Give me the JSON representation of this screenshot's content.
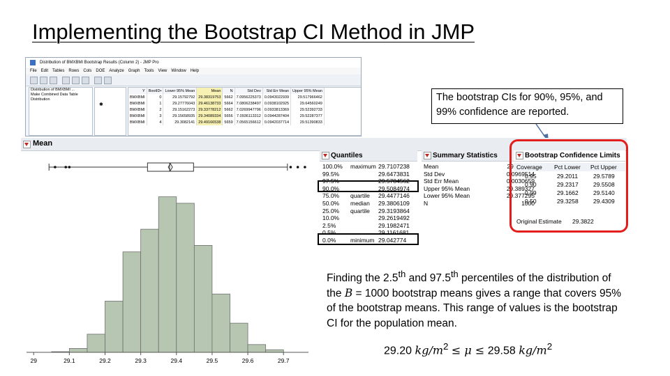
{
  "slide": {
    "title": "Implementing the Bootstrap CI Method in JMP",
    "callout": "The bootstrap CIs for 90%, 95%, and 99% confidence are reported."
  },
  "jmp_window": {
    "title": "Distribution of BMXBMI Bootstrap Results (Column 2) - JMP Pro",
    "menu": [
      "File",
      "Edit",
      "Tables",
      "Rows",
      "Cols",
      "DOE",
      "Analyze",
      "Graph",
      "Tools",
      "View",
      "Window",
      "Help"
    ],
    "left_panel": [
      "Distribution of BMXBMI ...",
      "Make Combined Data Table",
      "Distribution"
    ],
    "grid": {
      "columns": [
        "Y",
        "BootID•",
        "Lower 95% Mean",
        "Mean",
        "N",
        "Std Dev",
        "Std Err Mean",
        "Upper 95% Mean"
      ],
      "rows": [
        [
          "BMXBMI",
          "0",
          "29.15792792",
          "29.38319753",
          "5662",
          "7.0956225373",
          "0.0943022939",
          "29.517966462"
        ],
        [
          "BMXBMI",
          "1",
          "29.27776043",
          "29.46138733",
          "5664",
          "7.0806238497",
          "0.0938102925",
          "29.64560249"
        ],
        [
          "BMXBMI",
          "2",
          "29.15162273",
          "29.33778212",
          "5662",
          "7.0269947796",
          "0.0933813369",
          "29.52392733"
        ],
        [
          "BMXBMI",
          "3",
          "29.15658935",
          "29.34089334",
          "5656",
          "7.0936113312",
          "0.0944287404",
          "29.52287377"
        ],
        [
          "BMXBMI",
          "4",
          "29.3082141",
          "29.49166538",
          "5659",
          "7.0565156612",
          "0.0942037714",
          "29.51390833"
        ]
      ]
    }
  },
  "report": {
    "mean_header": "Mean",
    "quantiles_header": "Quantiles",
    "quantiles": [
      {
        "p": "100.0%",
        "label": "maximum",
        "value": "29.7107238"
      },
      {
        "p": "99.5%",
        "label": "",
        "value": "29.6473831"
      },
      {
        "p": "97.5%",
        "label": "",
        "value": "29.5784562"
      },
      {
        "p": "90.0%",
        "label": "",
        "value": "29.5084974"
      },
      {
        "p": "75.0%",
        "label": "quartile",
        "value": "29.4477146"
      },
      {
        "p": "50.0%",
        "label": "median",
        "value": "29.3806109"
      },
      {
        "p": "25.0%",
        "label": "quartile",
        "value": "29.3193864"
      },
      {
        "p": "10.0%",
        "label": "",
        "value": "29.2619492"
      },
      {
        "p": "2.5%",
        "label": "",
        "value": "29.1982471"
      },
      {
        "p": "0.5%",
        "label": "",
        "value": "29.1161681"
      },
      {
        "p": "0.0%",
        "label": "minimum",
        "value": "29.042774"
      }
    ],
    "summary_header": "Summary Statistics",
    "summary": [
      {
        "k": "Mean",
        "v": "29.383311"
      },
      {
        "k": "Std Dev",
        "v": "0.0969514"
      },
      {
        "k": "Std Err Mean",
        "v": "0.0030659"
      },
      {
        "k": "Upper 95% Mean",
        "v": "29.389327"
      },
      {
        "k": "Lower 95% Mean",
        "v": "29.377295"
      },
      {
        "k": "N",
        "v": "1000"
      }
    ],
    "bootstrap_header": "Bootstrap Confidence Limits",
    "bootstrap_columns": [
      "Coverage",
      "Pct Lower",
      "Pct Upper"
    ],
    "bootstrap": [
      {
        "coverage": "0.95",
        "lower": "29.2011",
        "upper": "29.5789"
      },
      {
        "coverage": "0.90",
        "lower": "29.2317",
        "upper": "29.5508"
      },
      {
        "coverage": "0.99",
        "lower": "29.1662",
        "upper": "29.5140"
      },
      {
        "coverage": "0.50",
        "lower": "29.3258",
        "upper": "29.4309"
      }
    ],
    "original_estimate_label": "Original Estimate",
    "original_estimate": "29.3822",
    "explanation": {
      "a1": "Finding the 2.5",
      "a1sup": "th",
      "a2": " and 97.5",
      "a2sup": "th",
      "a3": " percentiles of the distribution of the ",
      "B": "B",
      "a4": " = 1000 bootstrap means gives a range that covers 95% of the bootstrap means.    This range of values is the bootstrap CI for the population mean."
    },
    "formula": {
      "left": "29.20",
      "unit1": "kg/m",
      "sup1": "2",
      "mid": "≤ μ ≤",
      "right": "29.58",
      "unit2": "kg/m",
      "sup2": "2"
    }
  },
  "chart_data": {
    "type": "bar",
    "title": "",
    "xlabel": "",
    "ylabel": "",
    "x_ticks": [
      "29",
      "29.1",
      "29.2",
      "29.3",
      "29.4",
      "29.5",
      "29.6",
      "29.7"
    ],
    "bin_edges": [
      29.05,
      29.1,
      29.15,
      29.2,
      29.25,
      29.3,
      29.35,
      29.4,
      29.45,
      29.5,
      29.55,
      29.6,
      29.65,
      29.7
    ],
    "values": [
      1,
      6,
      28,
      79,
      155,
      190,
      240,
      230,
      165,
      90,
      45,
      12,
      4
    ],
    "xlim": [
      28.98,
      29.77
    ],
    "ylim": [
      0,
      260
    ],
    "boxplot": {
      "min": 29.043,
      "q1": 29.319,
      "median": 29.381,
      "mean": 29.383,
      "q3": 29.448,
      "max": 29.711,
      "outliers_low": [
        29.06,
        29.09,
        29.1
      ],
      "outliers_high": [
        29.72,
        29.74,
        29.76
      ]
    },
    "bar_color": "#b7c6b1",
    "grid": false
  }
}
